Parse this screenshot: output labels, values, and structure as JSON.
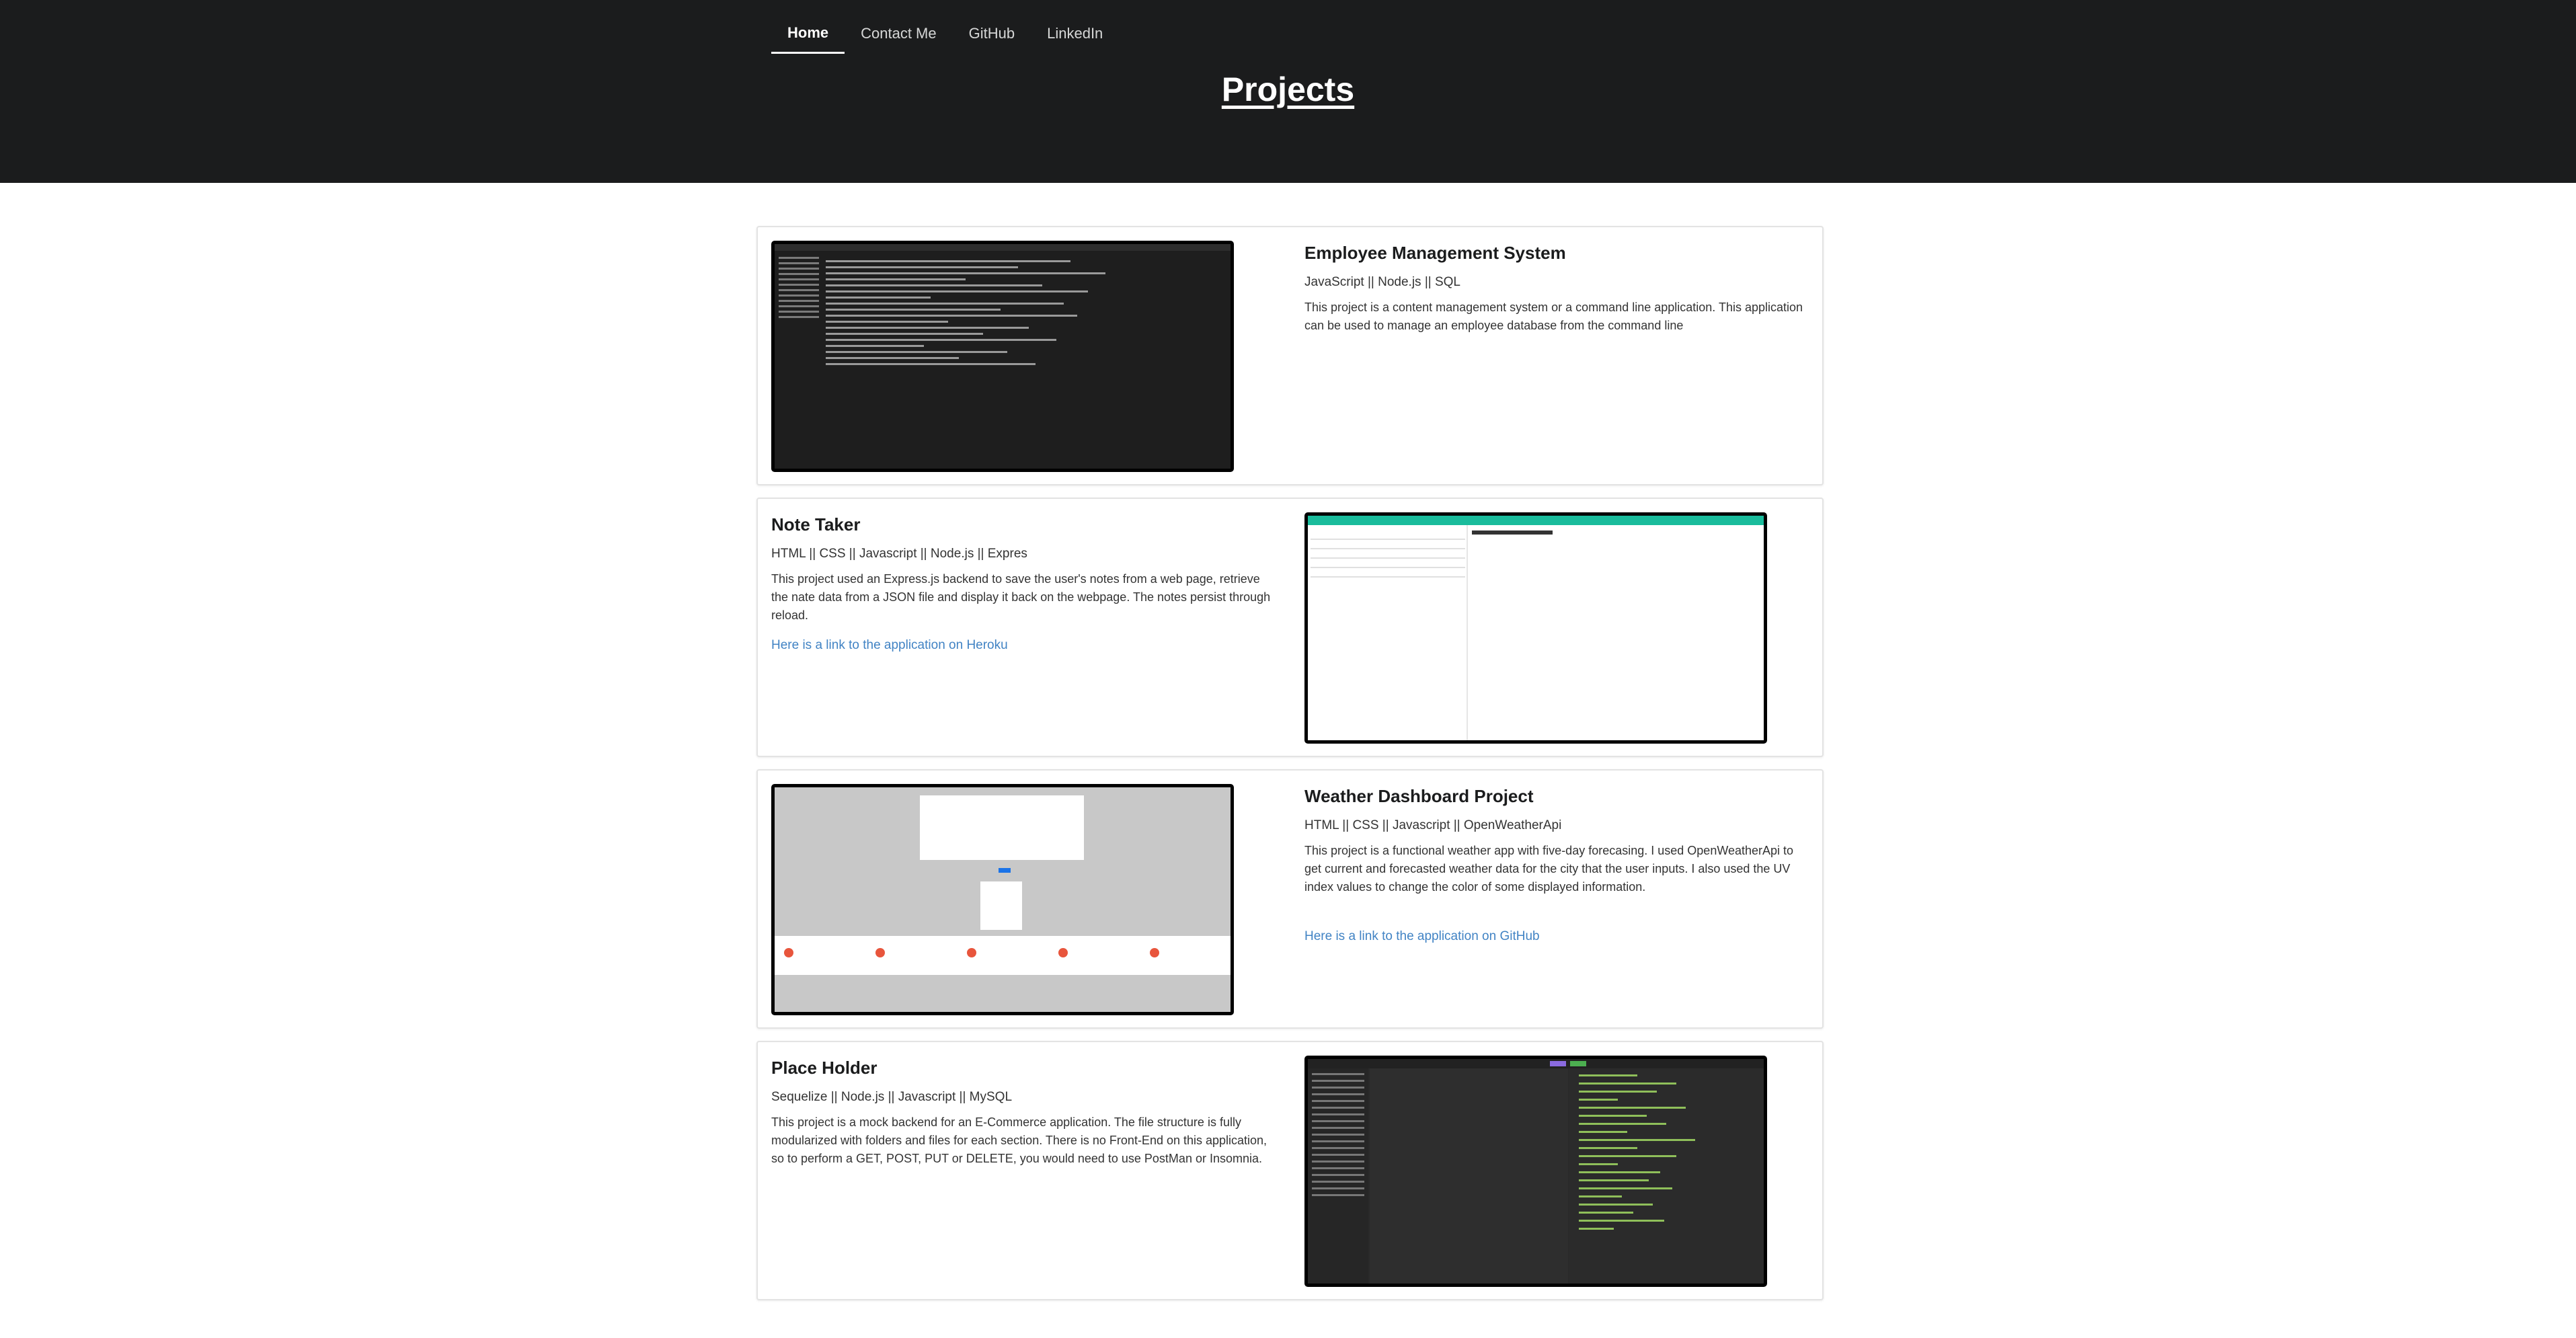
{
  "nav": {
    "items": [
      "Home",
      "Contact Me",
      "GitHub",
      "LinkedIn"
    ],
    "active": "Home"
  },
  "page_title": "Projects",
  "projects": [
    {
      "title": "Employee Management System",
      "tech": "JavaScript || Node.js || SQL",
      "description": "This project is a content management system or a command line application. This application can be used to manage an employee database from the command line",
      "link": "",
      "image": "terminal-screenshot"
    },
    {
      "title": "Note Taker",
      "tech": "HTML || CSS || Javascript || Node.js || Expres",
      "description": "This project used an Express.js backend to save the user's notes from a web page, retrieve the nate data from a JSON file and display it back on the webpage. The notes persist through reload.",
      "link": "Here is a link to the application on Heroku",
      "image": "note-taker-screenshot"
    },
    {
      "title": "Weather Dashboard Project",
      "tech": "HTML || CSS || Javascript || OpenWeatherApi",
      "description": "This project is a functional weather app with five-day forecasing. I used OpenWeatherApi to get current and forecasted weather data for the city that the user inputs. I also used the UV index values to change the color of some displayed information.",
      "link": "Here is a link to the application on GitHub",
      "image": "weather-dashboard-screenshot"
    },
    {
      "title": "Place Holder",
      "tech": "Sequelize || Node.js || Javascript || MySQL",
      "description": "This project is a mock backend for an E-Commerce application. The file structure is fully modularized with folders and files for each section. There is no Front-End on this application, so to perform a GET, POST, PUT or DELETE, you would need to use PostMan or Insomnia.",
      "link": "",
      "image": "insomnia-screenshot"
    }
  ],
  "colors": {
    "header_bg": "#1b1c1d",
    "link": "#4183c4",
    "note_bar": "#1abc9c"
  }
}
